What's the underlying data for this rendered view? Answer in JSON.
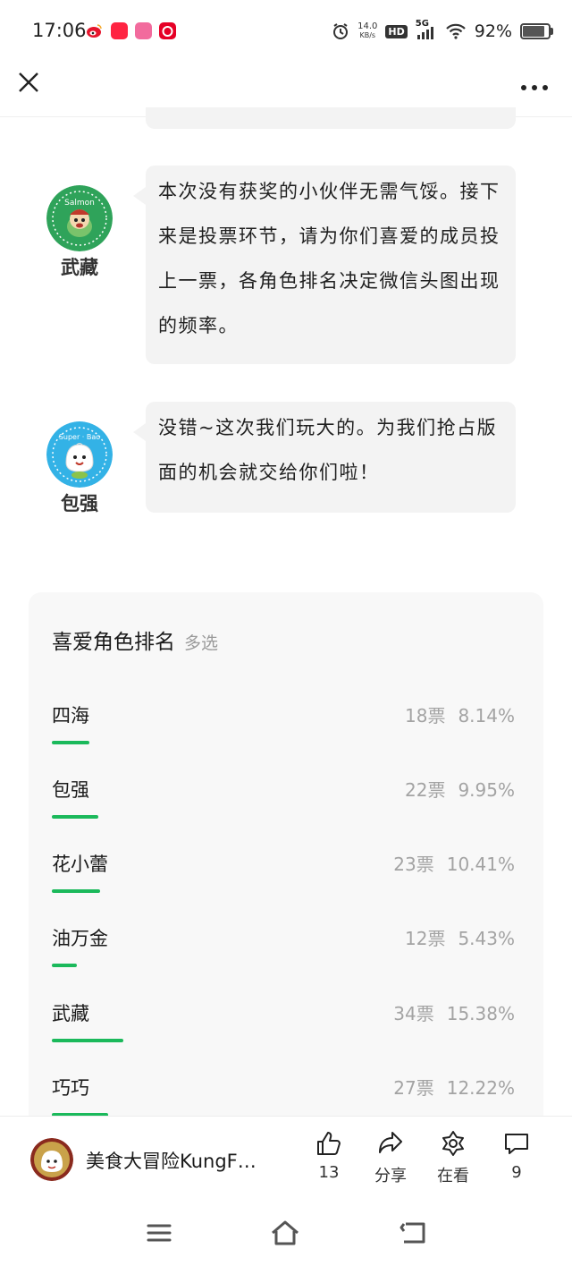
{
  "status_bar": {
    "time": "17:06",
    "net_speed_value": "14.0",
    "net_speed_unit": "KB/s",
    "hd": "HD",
    "network": "5G",
    "battery": "92%",
    "app_icons": [
      "weibo-icon",
      "xiaohongshu-icon",
      "lala-icon",
      "netease-music-icon"
    ]
  },
  "nav": {
    "close_icon": "close-icon",
    "more_icon": "more-icon"
  },
  "chat": {
    "messages": [
      {
        "speaker": "武藏",
        "text": "本次没有获奖的小伙伴无需气馁。接下来是投票环节，请为你们喜爱的成员投上一票，各角色排名决定微信头图出现的频率。",
        "avatar_label": "Salmon",
        "avatar_color": "#2fa35a"
      },
      {
        "speaker": "包强",
        "text": "没错~这次我们玩大的。为我们抢占版面的机会就交给你们啦！",
        "avatar_label": "Super · Bao",
        "avatar_color": "#33b2e6"
      }
    ]
  },
  "poll": {
    "title": "喜爱角色排名",
    "subtitle": "多选",
    "accent": "#1bb95b",
    "options": [
      {
        "label": "四海",
        "votes": "18票",
        "percent": "8.14%",
        "share": 0.0814
      },
      {
        "label": "包强",
        "votes": "22票",
        "percent": "9.95%",
        "share": 0.0995
      },
      {
        "label": "花小蕾",
        "votes": "23票",
        "percent": "10.41%",
        "share": 0.1041
      },
      {
        "label": "油万金",
        "votes": "12票",
        "percent": "5.43%",
        "share": 0.0543
      },
      {
        "label": "武藏",
        "votes": "34票",
        "percent": "15.38%",
        "share": 0.1538
      },
      {
        "label": "巧巧",
        "votes": "27票",
        "percent": "12.22%",
        "share": 0.1222
      }
    ]
  },
  "action_bar": {
    "account_name": "美食大冒险KungF…",
    "like_count": "13",
    "share_label": "分享",
    "watching_label": "在看",
    "comment_count": "9"
  },
  "system_nav": {
    "menu_icon": "menu-icon",
    "home_icon": "home-icon",
    "back_icon": "back-icon"
  }
}
